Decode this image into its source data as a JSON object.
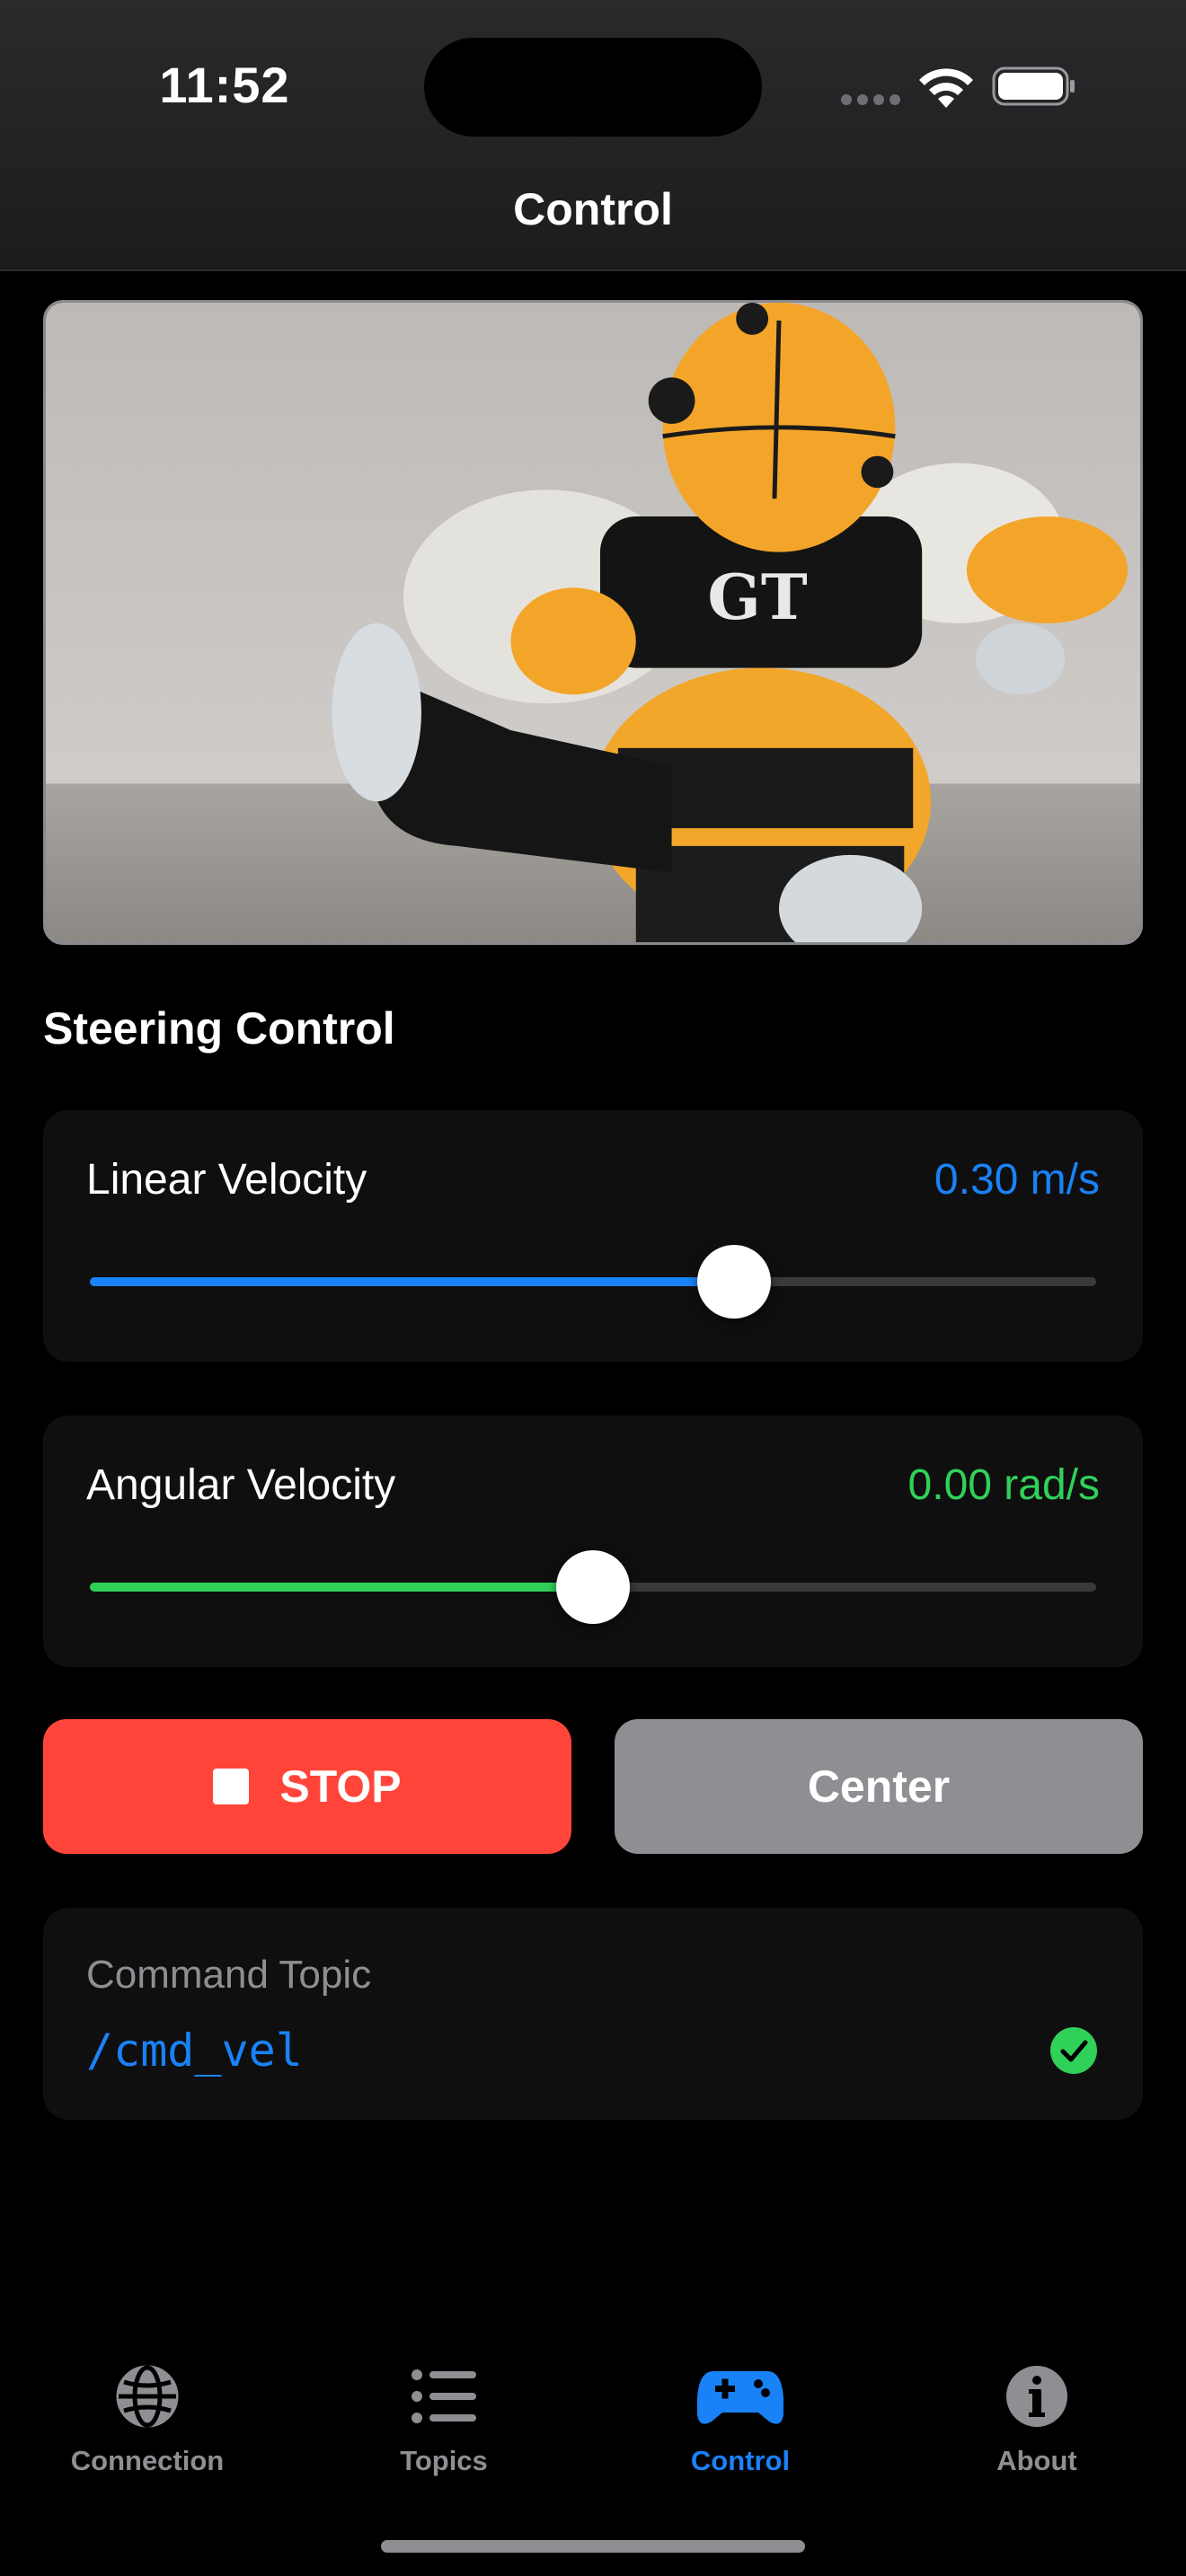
{
  "status_bar": {
    "time": "11:52"
  },
  "nav": {
    "title": "Control"
  },
  "camera": {
    "description_icon": "camera-feed-image"
  },
  "steering": {
    "title": "Steering Control",
    "linear": {
      "label": "Linear Velocity",
      "value_text": "0.30 m/s",
      "fraction": 0.64,
      "color": "#1a82f7"
    },
    "angular": {
      "label": "Angular Velocity",
      "value_text": "0.00 rad/s",
      "fraction": 0.5,
      "color": "#30d158"
    }
  },
  "buttons": {
    "stop_label": "STOP",
    "center_label": "Center"
  },
  "topic": {
    "label": "Command Topic",
    "value": "/cmd_vel",
    "value_color": "#1a82f7",
    "status_icon": "checkmark-circle-icon"
  },
  "tabs": [
    {
      "label": "Connection",
      "icon": "globe-icon",
      "active": false
    },
    {
      "label": "Topics",
      "icon": "list-icon",
      "active": false
    },
    {
      "label": "Control",
      "icon": "gamecontroller-icon",
      "active": true
    },
    {
      "label": "About",
      "icon": "info-icon",
      "active": false
    }
  ],
  "colors": {
    "active_tab": "#1a82f7",
    "inactive_tab": "#8e8e93",
    "stop": "#ff453a",
    "center": "#8e8e93"
  }
}
